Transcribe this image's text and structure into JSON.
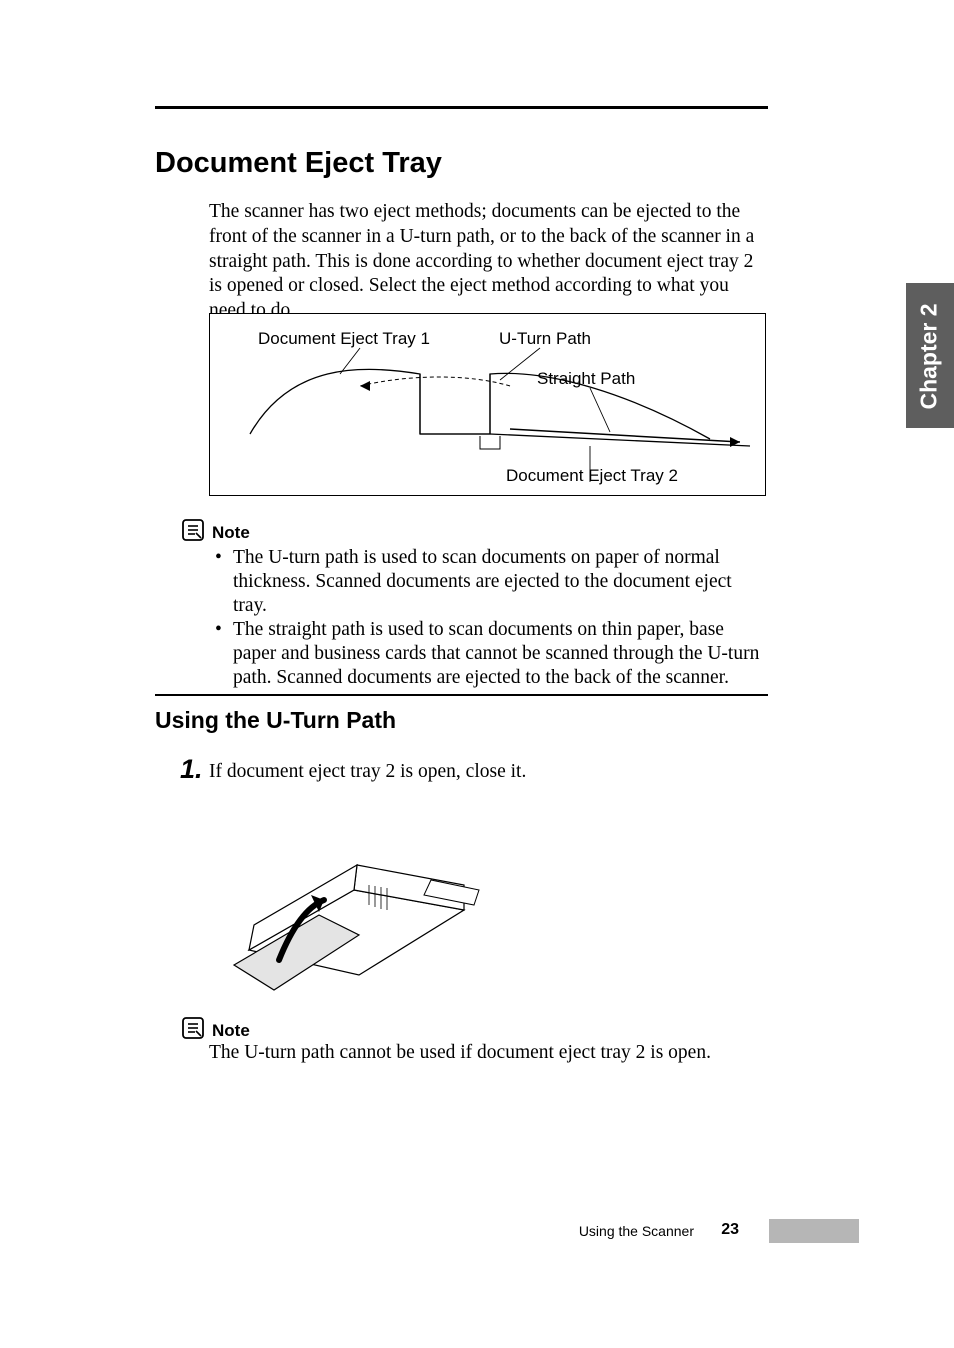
{
  "heading1": "Document Eject Tray",
  "intro": "The scanner has two eject methods; documents can be ejected to the front of the scanner in a U-turn path, or to the back of the scanner in a straight path. This is done according to whether document eject tray 2 is opened or closed. Select the eject method according to what you need to do.",
  "diagram": {
    "label_tray1": "Document Eject Tray 1",
    "label_uturn": "U-Turn Path",
    "label_straight": "Straight Path",
    "label_tray2": "Document Eject Tray 2"
  },
  "chapter_tab": "Chapter 2",
  "note_label": "Note",
  "note1_bullets": [
    "The U-turn path is used to scan documents on paper of normal thickness. Scanned documents are ejected to the document eject tray.",
    "The straight path is used to scan documents on thin paper, base paper and business cards that cannot be scanned through the U-turn path. Scanned documents are ejected to the back of the scanner."
  ],
  "heading2": "Using the U-Turn Path",
  "step1_num": "1.",
  "step1_text": "If document eject tray 2 is open, close it.",
  "note2_text": "The U-turn path cannot be used if document eject tray 2 is open.",
  "footer_section": "Using the Scanner",
  "footer_page": "23"
}
